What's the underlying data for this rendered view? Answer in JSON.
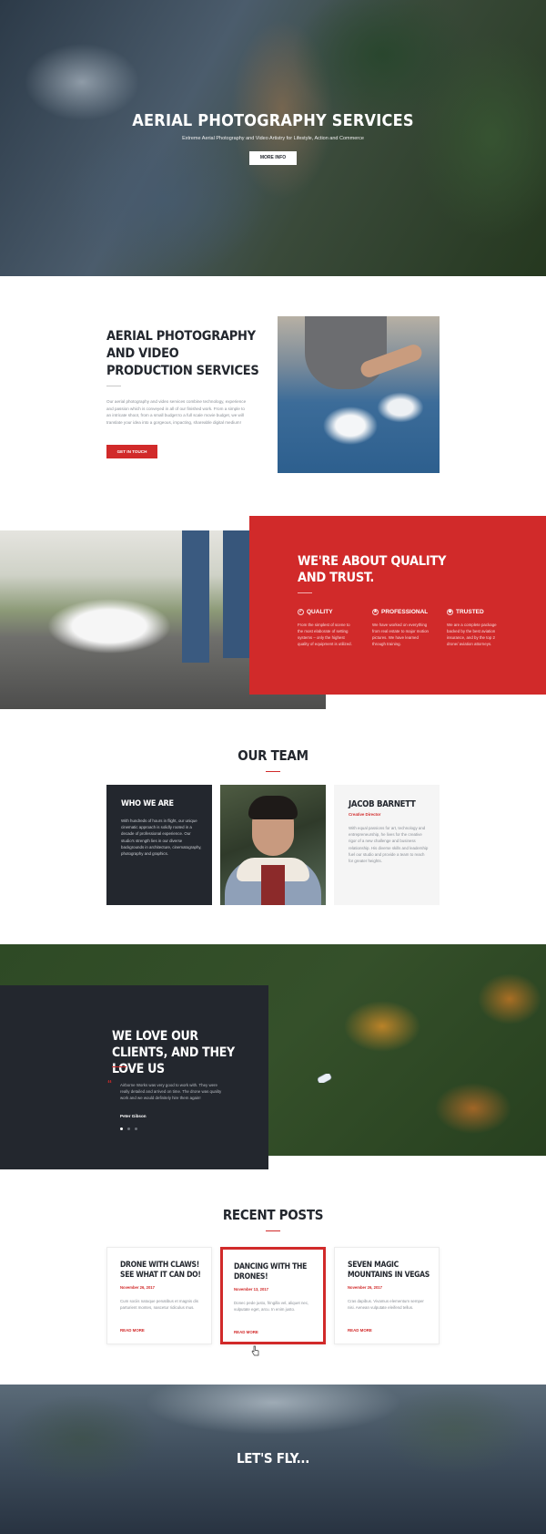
{
  "hero": {
    "title": "AERIAL PHOTOGRAPHY SERVICES",
    "subtitle": "Extreme Aerial Photography and Video Artistry for Lifestyle, Action and Commerce",
    "button": "MORE INFO"
  },
  "about": {
    "title": "AERIAL PHOTOGRAPHY AND VIDEO PRODUCTION SERVICES",
    "body": "Our aerial photography and video services combine technology, experience and passion which is conveyed in all of our finished work. From a simple to an intricate shoot, from a small budget to a full scale movie budget, we will translate your idea into a gorgeous, impacting, shareable digital medium!",
    "button": "GET IN TOUCH"
  },
  "quality": {
    "title": "WE'RE ABOUT QUALITY AND TRUST.",
    "features": [
      {
        "title": "QUALITY",
        "text": "From the simplest of scene to the most elaborate of setting systems – only the highest quality of equipment is utilized."
      },
      {
        "title": "PROFESSIONAL",
        "text": "We have worked on everything from real estate to major motion pictures. We have learned through training."
      },
      {
        "title": "TRUSTED",
        "text": "We are a complete package backed by the best aviation insurance, and by the top 2 drone/ aviation attorneys."
      }
    ]
  },
  "team": {
    "title": "OUR TEAM",
    "who": {
      "title": "WHO WE ARE",
      "text": "With hundreds of hours in flight, our unique cinematic approach is solidly rooted in a decade of professional experience. Our studio's strength lies in our diverse backgrounds in architecture, cinematography, photography and graphics."
    },
    "member": {
      "name": "JACOB BARNETT",
      "role": "Creative Director",
      "text": "With equal passions for art, technology and entrepreneurship, he lives for the creative rigor of a new challenge and business relationship. His diverse skills and leadership fuel our studio and provide a team to reach for greater heights."
    }
  },
  "testimonial": {
    "title": "WE LOVE OUR CLIENTS, AND THEY LOVE US",
    "quote": "Airborne Works was very good to work with. They were really detailed and arrived on time. The drone was quality work and we would definitely hire them again!",
    "author": "Peter Gibson"
  },
  "posts": {
    "title": "RECENT POSTS",
    "items": [
      {
        "title": "DRONE WITH CLAWS! SEE WHAT IT CAN DO!",
        "date": "November 26, 2017",
        "excerpt": "Cum sociis natoque penatibus et magnis dis parturient montes, nascetur ridiculus mus.",
        "read_more": "READ MORE"
      },
      {
        "title": "DANCING WITH THE DRONES!",
        "date": "November 13, 2017",
        "excerpt": "Donec pede justo, fringilla vel, aliquet nec, vulputate eget, arcu. In enim justo.",
        "read_more": "READ MORE"
      },
      {
        "title": "SEVEN MAGIC MOUNTAINS IN VEGAS",
        "date": "November 26, 2017",
        "excerpt": "Cras dapibus. Vivamus elementum semper nisi. Aenean vulputate eleifend tellus.",
        "read_more": "READ MORE"
      }
    ]
  },
  "footer": {
    "title": "LET'S FLY..."
  },
  "colors": {
    "accent": "#d12a2a",
    "dark": "#23272e"
  }
}
